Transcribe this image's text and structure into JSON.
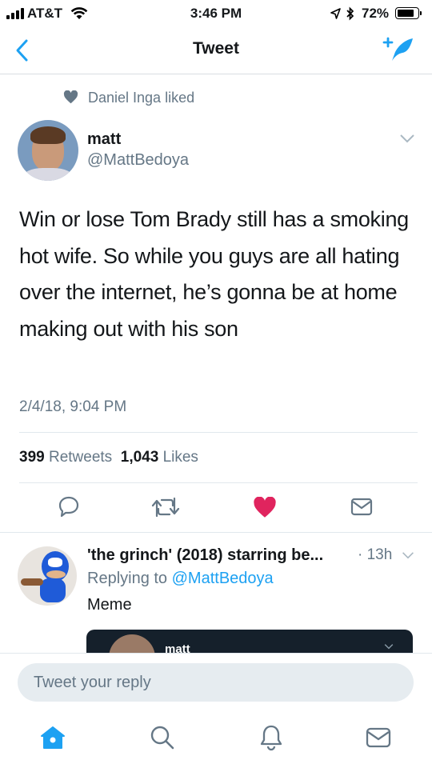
{
  "status_bar": {
    "carrier": "AT&T",
    "time": "3:46 PM",
    "battery": "72%"
  },
  "nav": {
    "title": "Tweet"
  },
  "liked_by": "Daniel Inga liked",
  "tweet": {
    "name": "matt",
    "handle": "@MattBedoya",
    "text": "Win or lose Tom Brady still has a smoking hot wife. So while you guys are all hating over the internet, he’s gonna be at home making out with his son",
    "timestamp": "2/4/18, 9:04 PM",
    "retweets_count": "399",
    "retweets_label": "Retweets",
    "likes_count": "1,043",
    "likes_label": "Likes"
  },
  "reply": {
    "name": "'the grinch' (2018) starring be...",
    "dot": "·",
    "time": "13h",
    "replying_prefix": "Replying to",
    "replying_handle": "@MattBedoya",
    "text": "Meme",
    "quoted_name": "matt"
  },
  "composer": {
    "placeholder": "Tweet your reply"
  },
  "colors": {
    "accent": "#1da1f2",
    "like": "#e0245e",
    "muted": "#657786"
  }
}
